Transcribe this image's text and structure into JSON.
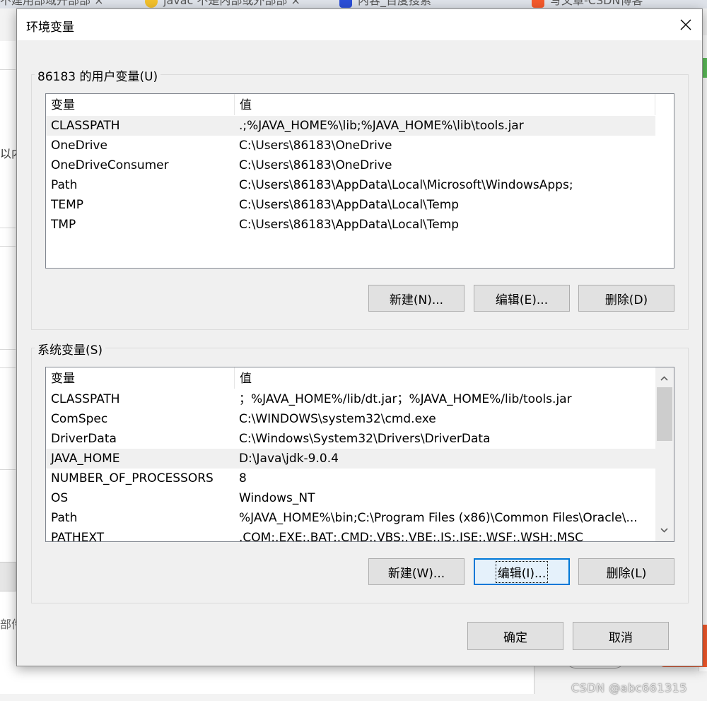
{
  "background": {
    "tabs": [
      {
        "label": "不建用部域开部部 ×",
        "icon": "browser-tab-icon"
      },
      {
        "label": "javac 不是内部或外部部 ×",
        "icon": "emoji-tab-icon"
      },
      {
        "label": "内容_百度搜索",
        "icon": "baidu-icon"
      },
      {
        "label": "写文章-CSDN博客",
        "icon": "csdn-icon"
      }
    ],
    "side_text_1": "以内",
    "side_text_2": "部件",
    "watermark": "CSDN @abc661315"
  },
  "dialog": {
    "title": "环境变量",
    "user_group": {
      "label": "86183 的用户变量(U)",
      "columns": [
        "变量",
        "值"
      ],
      "rows": [
        {
          "name": "CLASSPATH",
          "value": ".;%JAVA_HOME%\\lib;%JAVA_HOME%\\lib\\tools.jar",
          "selected": true
        },
        {
          "name": "OneDrive",
          "value": "C:\\Users\\86183\\OneDrive",
          "selected": false
        },
        {
          "name": "OneDriveConsumer",
          "value": "C:\\Users\\86183\\OneDrive",
          "selected": false
        },
        {
          "name": "Path",
          "value": "C:\\Users\\86183\\AppData\\Local\\Microsoft\\WindowsApps;",
          "selected": false
        },
        {
          "name": "TEMP",
          "value": "C:\\Users\\86183\\AppData\\Local\\Temp",
          "selected": false
        },
        {
          "name": "TMP",
          "value": "C:\\Users\\86183\\AppData\\Local\\Temp",
          "selected": false
        }
      ],
      "buttons": {
        "new": "新建(N)...",
        "edit": "编辑(E)...",
        "delete": "删除(D)"
      }
    },
    "system_group": {
      "label": "系统变量(S)",
      "columns": [
        "变量",
        "值"
      ],
      "rows": [
        {
          "name": "CLASSPATH",
          "value": "；%JAVA_HOME%/lib/dt.jar；%JAVA_HOME%/lib/tools.jar",
          "selected": false
        },
        {
          "name": "ComSpec",
          "value": "C:\\WINDOWS\\system32\\cmd.exe",
          "selected": false
        },
        {
          "name": "DriverData",
          "value": "C:\\Windows\\System32\\Drivers\\DriverData",
          "selected": false
        },
        {
          "name": "JAVA_HOME",
          "value": "D:\\Java\\jdk-9.0.4",
          "selected": true
        },
        {
          "name": "NUMBER_OF_PROCESSORS",
          "value": "8",
          "selected": false
        },
        {
          "name": "OS",
          "value": "Windows_NT",
          "selected": false
        },
        {
          "name": "Path",
          "value": "%JAVA_HOME%\\bin;C:\\Program Files (x86)\\Common Files\\Oracle\\...",
          "selected": false
        },
        {
          "name": "PATHEXT",
          "value": ".COM;.EXE;.BAT;.CMD;.VBS;.VBE;.JS;.JSE;.WSF;.WSH;.MSC",
          "selected": false
        }
      ],
      "buttons": {
        "new": "新建(W)...",
        "edit": "编辑(I)...",
        "delete": "删除(L)"
      }
    },
    "ok_label": "确定",
    "cancel_label": "取消"
  },
  "colors": {
    "selection": "#f0f0f0",
    "focus": "#0078d7",
    "button": "#e1e1e1",
    "csdn_orange": "#f55a2c"
  }
}
